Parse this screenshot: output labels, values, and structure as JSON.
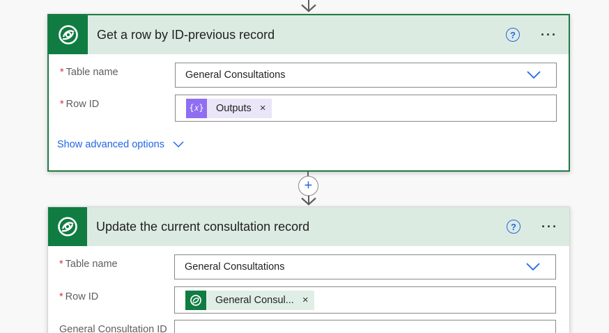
{
  "colors": {
    "accent": "#107c41",
    "header_bg": "#dcebe2",
    "link": "#2266e3",
    "required": "#d13438",
    "token_purple": "#8f6ef2"
  },
  "card1": {
    "title": "Get a row by ID-previous record",
    "help_symbol": "?",
    "more_symbol": "···",
    "table_label": "Table name",
    "table_value": "General Consultations",
    "rowid_label": "Row ID",
    "token_label": "Outputs",
    "token_icon_text": "{𝑥}",
    "token_remove": "×",
    "advanced_link": "Show advanced options",
    "required_mark": "*",
    "logo_icon": "dataverse-icon"
  },
  "card2": {
    "title": "Update the current consultation record",
    "help_symbol": "?",
    "more_symbol": "···",
    "table_label": "Table name",
    "table_value": "General Consultations",
    "rowid_label": "Row ID",
    "token_label": "General Consul...",
    "token_remove": "×",
    "extra_label": "General Consultation ID",
    "required_mark": "*",
    "logo_icon": "dataverse-icon"
  },
  "connector": {
    "add_symbol": "+"
  }
}
